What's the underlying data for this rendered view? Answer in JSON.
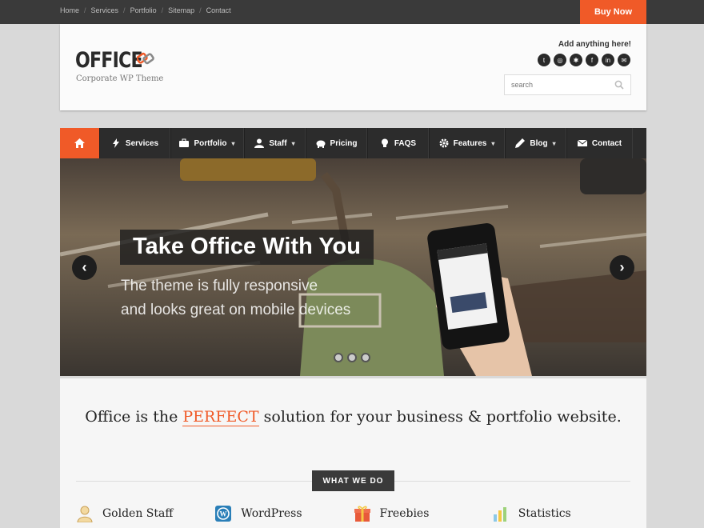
{
  "topnav": [
    "Home",
    "Services",
    "Portfolio",
    "Sitemap",
    "Contact"
  ],
  "buy_label": "Buy Now",
  "header": {
    "logo": "OFFICE",
    "tagline": "Corporate WP Theme",
    "add_anything": "Add anything here!",
    "social_icons": [
      "twitter-icon",
      "dribbble-icon",
      "yelp-icon",
      "facebook-icon",
      "linkedin-icon",
      "email-icon"
    ],
    "search_placeholder": "search"
  },
  "nav": {
    "items": [
      {
        "label": "Services",
        "icon": "lightning-icon",
        "dropdown": false
      },
      {
        "label": "Portfolio",
        "icon": "briefcase-icon",
        "dropdown": true
      },
      {
        "label": "Staff",
        "icon": "person-icon",
        "dropdown": true
      },
      {
        "label": "Pricing",
        "icon": "piggybank-icon",
        "dropdown": false
      },
      {
        "label": "FAQS",
        "icon": "lightbulb-icon",
        "dropdown": false
      },
      {
        "label": "Features",
        "icon": "gear-icon",
        "dropdown": true
      },
      {
        "label": "Blog",
        "icon": "pencil-icon",
        "dropdown": true
      },
      {
        "label": "Contact",
        "icon": "envelope-icon",
        "dropdown": false
      }
    ]
  },
  "slider": {
    "title": "Take Office With You",
    "subtitle_line1": "The theme is fully responsive",
    "subtitle_line2": "and looks great on mobile devices",
    "prev": "‹",
    "next": "›",
    "slide_count": 3
  },
  "main": {
    "lead_before": "Office is the ",
    "lead_highlight": "PERFECT",
    "lead_after": " solution for your business & portfolio website.",
    "section_label": "WHAT WE DO",
    "features": [
      {
        "label": "Golden Staff",
        "icon": "person-icon"
      },
      {
        "label": "WordPress",
        "icon": "wordpress-icon"
      },
      {
        "label": "Freebies",
        "icon": "gift-icon"
      },
      {
        "label": "Statistics",
        "icon": "chart-icon"
      }
    ]
  },
  "colors": {
    "accent": "#f05a28",
    "dark": "#2c2c2c",
    "topbar": "#3a3a3a"
  }
}
